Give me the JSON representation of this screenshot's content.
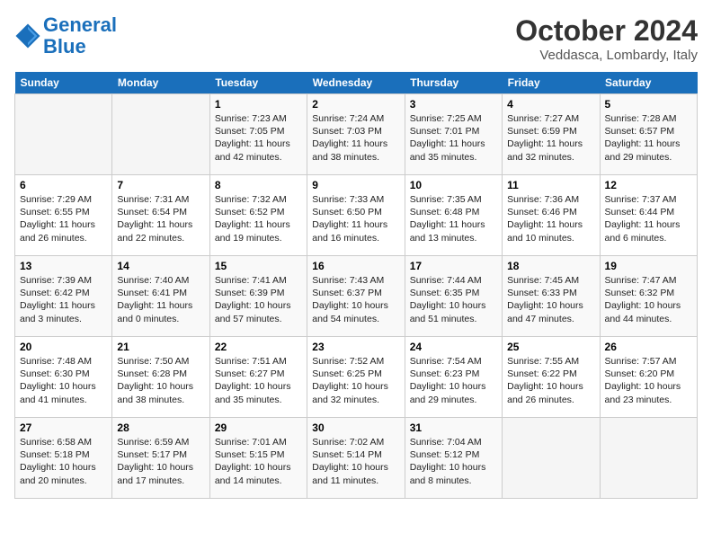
{
  "header": {
    "logo_line1": "General",
    "logo_line2": "Blue",
    "month": "October 2024",
    "location": "Veddasca, Lombardy, Italy"
  },
  "weekdays": [
    "Sunday",
    "Monday",
    "Tuesday",
    "Wednesday",
    "Thursday",
    "Friday",
    "Saturday"
  ],
  "weeks": [
    [
      {
        "day": "",
        "info": ""
      },
      {
        "day": "",
        "info": ""
      },
      {
        "day": "1",
        "info": "Sunrise: 7:23 AM\nSunset: 7:05 PM\nDaylight: 11 hours and 42 minutes."
      },
      {
        "day": "2",
        "info": "Sunrise: 7:24 AM\nSunset: 7:03 PM\nDaylight: 11 hours and 38 minutes."
      },
      {
        "day": "3",
        "info": "Sunrise: 7:25 AM\nSunset: 7:01 PM\nDaylight: 11 hours and 35 minutes."
      },
      {
        "day": "4",
        "info": "Sunrise: 7:27 AM\nSunset: 6:59 PM\nDaylight: 11 hours and 32 minutes."
      },
      {
        "day": "5",
        "info": "Sunrise: 7:28 AM\nSunset: 6:57 PM\nDaylight: 11 hours and 29 minutes."
      }
    ],
    [
      {
        "day": "6",
        "info": "Sunrise: 7:29 AM\nSunset: 6:55 PM\nDaylight: 11 hours and 26 minutes."
      },
      {
        "day": "7",
        "info": "Sunrise: 7:31 AM\nSunset: 6:54 PM\nDaylight: 11 hours and 22 minutes."
      },
      {
        "day": "8",
        "info": "Sunrise: 7:32 AM\nSunset: 6:52 PM\nDaylight: 11 hours and 19 minutes."
      },
      {
        "day": "9",
        "info": "Sunrise: 7:33 AM\nSunset: 6:50 PM\nDaylight: 11 hours and 16 minutes."
      },
      {
        "day": "10",
        "info": "Sunrise: 7:35 AM\nSunset: 6:48 PM\nDaylight: 11 hours and 13 minutes."
      },
      {
        "day": "11",
        "info": "Sunrise: 7:36 AM\nSunset: 6:46 PM\nDaylight: 11 hours and 10 minutes."
      },
      {
        "day": "12",
        "info": "Sunrise: 7:37 AM\nSunset: 6:44 PM\nDaylight: 11 hours and 6 minutes."
      }
    ],
    [
      {
        "day": "13",
        "info": "Sunrise: 7:39 AM\nSunset: 6:42 PM\nDaylight: 11 hours and 3 minutes."
      },
      {
        "day": "14",
        "info": "Sunrise: 7:40 AM\nSunset: 6:41 PM\nDaylight: 11 hours and 0 minutes."
      },
      {
        "day": "15",
        "info": "Sunrise: 7:41 AM\nSunset: 6:39 PM\nDaylight: 10 hours and 57 minutes."
      },
      {
        "day": "16",
        "info": "Sunrise: 7:43 AM\nSunset: 6:37 PM\nDaylight: 10 hours and 54 minutes."
      },
      {
        "day": "17",
        "info": "Sunrise: 7:44 AM\nSunset: 6:35 PM\nDaylight: 10 hours and 51 minutes."
      },
      {
        "day": "18",
        "info": "Sunrise: 7:45 AM\nSunset: 6:33 PM\nDaylight: 10 hours and 47 minutes."
      },
      {
        "day": "19",
        "info": "Sunrise: 7:47 AM\nSunset: 6:32 PM\nDaylight: 10 hours and 44 minutes."
      }
    ],
    [
      {
        "day": "20",
        "info": "Sunrise: 7:48 AM\nSunset: 6:30 PM\nDaylight: 10 hours and 41 minutes."
      },
      {
        "day": "21",
        "info": "Sunrise: 7:50 AM\nSunset: 6:28 PM\nDaylight: 10 hours and 38 minutes."
      },
      {
        "day": "22",
        "info": "Sunrise: 7:51 AM\nSunset: 6:27 PM\nDaylight: 10 hours and 35 minutes."
      },
      {
        "day": "23",
        "info": "Sunrise: 7:52 AM\nSunset: 6:25 PM\nDaylight: 10 hours and 32 minutes."
      },
      {
        "day": "24",
        "info": "Sunrise: 7:54 AM\nSunset: 6:23 PM\nDaylight: 10 hours and 29 minutes."
      },
      {
        "day": "25",
        "info": "Sunrise: 7:55 AM\nSunset: 6:22 PM\nDaylight: 10 hours and 26 minutes."
      },
      {
        "day": "26",
        "info": "Sunrise: 7:57 AM\nSunset: 6:20 PM\nDaylight: 10 hours and 23 minutes."
      }
    ],
    [
      {
        "day": "27",
        "info": "Sunrise: 6:58 AM\nSunset: 5:18 PM\nDaylight: 10 hours and 20 minutes."
      },
      {
        "day": "28",
        "info": "Sunrise: 6:59 AM\nSunset: 5:17 PM\nDaylight: 10 hours and 17 minutes."
      },
      {
        "day": "29",
        "info": "Sunrise: 7:01 AM\nSunset: 5:15 PM\nDaylight: 10 hours and 14 minutes."
      },
      {
        "day": "30",
        "info": "Sunrise: 7:02 AM\nSunset: 5:14 PM\nDaylight: 10 hours and 11 minutes."
      },
      {
        "day": "31",
        "info": "Sunrise: 7:04 AM\nSunset: 5:12 PM\nDaylight: 10 hours and 8 minutes."
      },
      {
        "day": "",
        "info": ""
      },
      {
        "day": "",
        "info": ""
      }
    ]
  ]
}
